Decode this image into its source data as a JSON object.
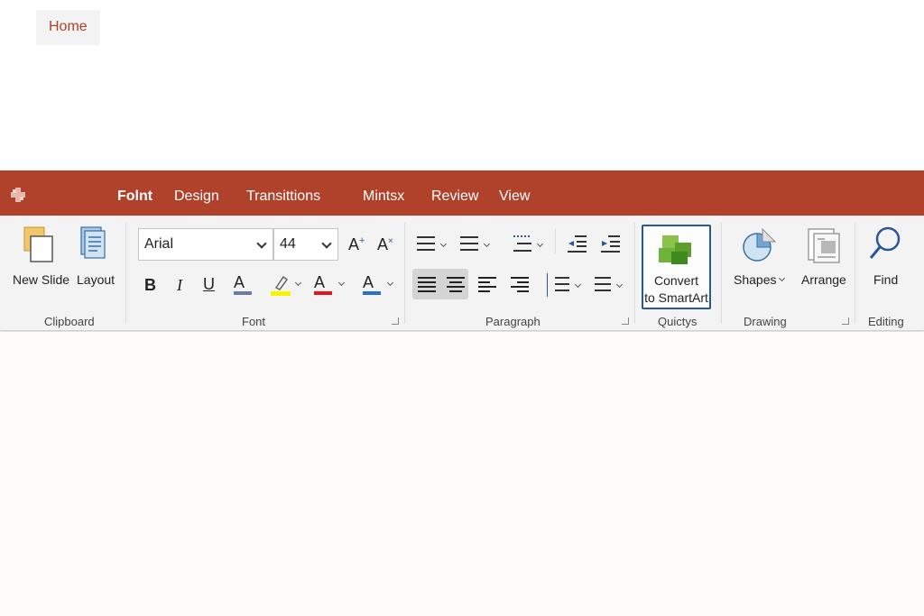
{
  "tabs": [
    {
      "label": "Home",
      "active": true
    },
    {
      "label": "Folnt",
      "bold": true
    },
    {
      "label": "Design"
    },
    {
      "label": "Transittions"
    },
    {
      "label": "Mintsx"
    },
    {
      "label": "Review"
    },
    {
      "label": "View"
    }
  ],
  "clipboard": {
    "new_slide": "New Slide",
    "layout": "Layout",
    "label": "Clipboard"
  },
  "font": {
    "font_name": "Arial",
    "font_size": "44",
    "bold": "B",
    "italic": "I",
    "underline": "U",
    "font_color_letter": "A",
    "highlight_color": "#f5f500",
    "font_color": "#e81123",
    "shading_color": "#2672c9",
    "underline_color": "#6b7fa5",
    "grow": "A",
    "shrink": "A",
    "label": "Font"
  },
  "paragraph": {
    "label": "Paragraph"
  },
  "quick": {
    "convert_line1": "Convert",
    "convert_line2": "to SmartArt",
    "label": "Quictys"
  },
  "drawing": {
    "shapes": "Shapes",
    "arrange": "Arrange",
    "label": "Drawing"
  },
  "editing": {
    "find": "Find",
    "label": "Editing"
  },
  "colors": {
    "accent": "#b0412b",
    "ribbon_bg": "#f3f3f3",
    "smartart_border": "#2b5797"
  }
}
